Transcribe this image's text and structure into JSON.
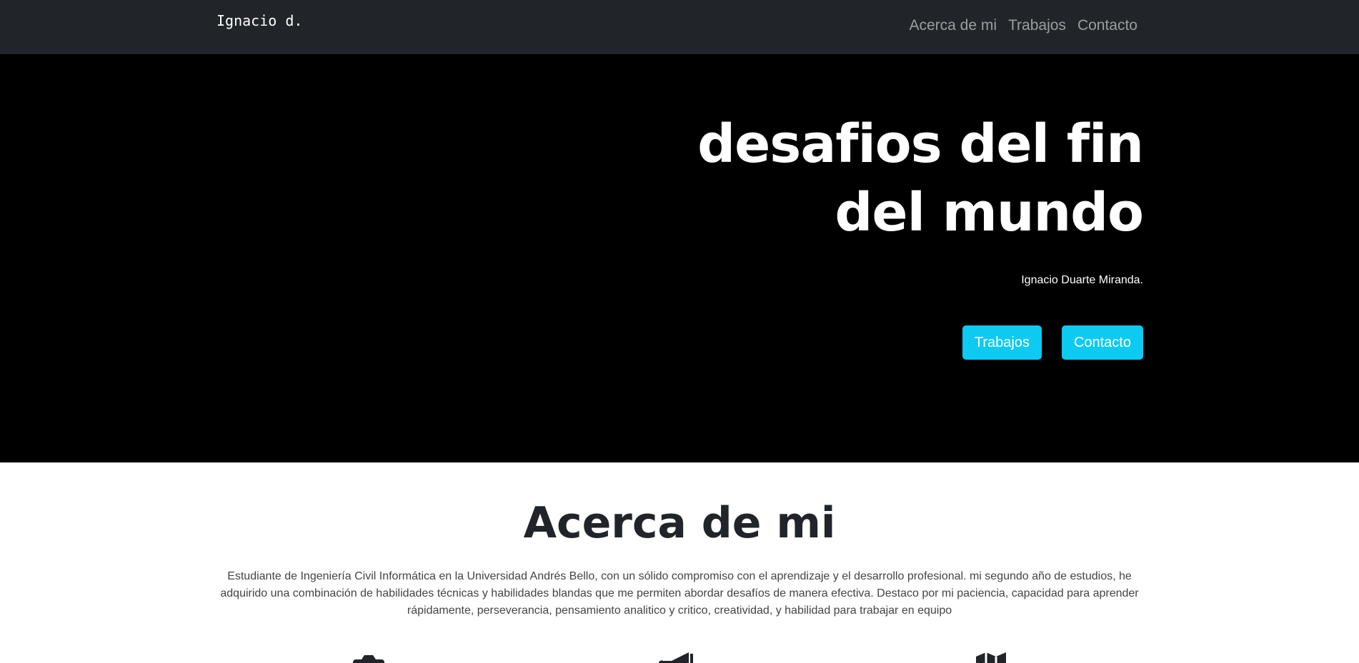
{
  "navbar": {
    "brand": "Ignacio d.",
    "links": [
      {
        "label": "Acerca de mi"
      },
      {
        "label": "Trabajos"
      },
      {
        "label": "Contacto"
      }
    ]
  },
  "hero": {
    "title_line1": "desafios del fin",
    "title_line2": "del mundo",
    "subtitle": "Ignacio Duarte Miranda.",
    "buttons": [
      {
        "label": "Trabajos"
      },
      {
        "label": "Contacto"
      }
    ],
    "button_color": "#0dcaf0"
  },
  "about": {
    "title": "Acerca de mi",
    "text": "Estudiante de Ingeniería Civil Informática en la Universidad Andrés Bello, con un sólido compromiso con el aprendizaje y el desarrollo profesional. mi segundo año de estudios, he adquirido una combinación de habilidades técnicas y habilidades blandas que me permiten abordar desafíos de manera efectiva. Destaco por mi paciencia, capacidad para aprender rápidamente, perseverancia, pensamiento analitico y critico, creatividad, y habilidad para trabajar en equipo",
    "icons": [
      "camera-icon",
      "megaphone-icon",
      "map-icon"
    ]
  },
  "colors": {
    "navbar_bg": "#212529",
    "hero_bg": "#000000",
    "accent": "#0dcaf0"
  }
}
